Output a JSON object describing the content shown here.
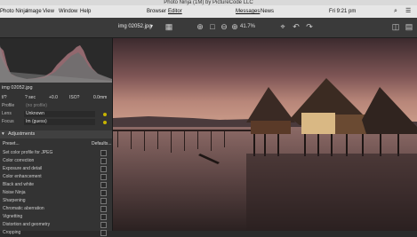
{
  "title_bar": {
    "text": "Photo Ninja (1M) by PictureCode LLC"
  },
  "menu": {
    "items": [
      {
        "label": "Photo Ninja"
      },
      {
        "label": "Image"
      },
      {
        "label": "View"
      },
      {
        "label": "Window"
      },
      {
        "label": "Help"
      }
    ],
    "views": [
      {
        "label": "Browser"
      },
      {
        "label": "Editor"
      }
    ],
    "right": [
      {
        "label": "Messages"
      },
      {
        "label": "News"
      }
    ],
    "clock": "Fri 9:21 pm"
  },
  "toolbar": {
    "file": "img 02052.jpg",
    "zoom": "41.7%"
  },
  "left_panel": {
    "filename": "img 02052.jpg",
    "exif": [
      "f/?",
      "? sec",
      "+0.0",
      "ISO?",
      "0.0mm"
    ],
    "properties": [
      {
        "label": "Profile",
        "value": "(no profile)"
      },
      {
        "label": "Lens",
        "value": "Unknown"
      },
      {
        "label": "Focus",
        "value": "Im (guess)"
      }
    ],
    "adjustments_title": "Adjustments",
    "preset_label": "Preset...",
    "defaults_label": "Defaults...",
    "adjustments": [
      "Set color profile for JPEG",
      "Color correction",
      "Exposure and detail",
      "Color enhancement",
      "Black and white",
      "Noise Ninja",
      "Sharpening",
      "Chromatic aberration",
      "Vignetting",
      "Distortion and geometry",
      "Cropping"
    ]
  },
  "colors": {
    "accent": "#c7b300",
    "panel": "#333333"
  }
}
